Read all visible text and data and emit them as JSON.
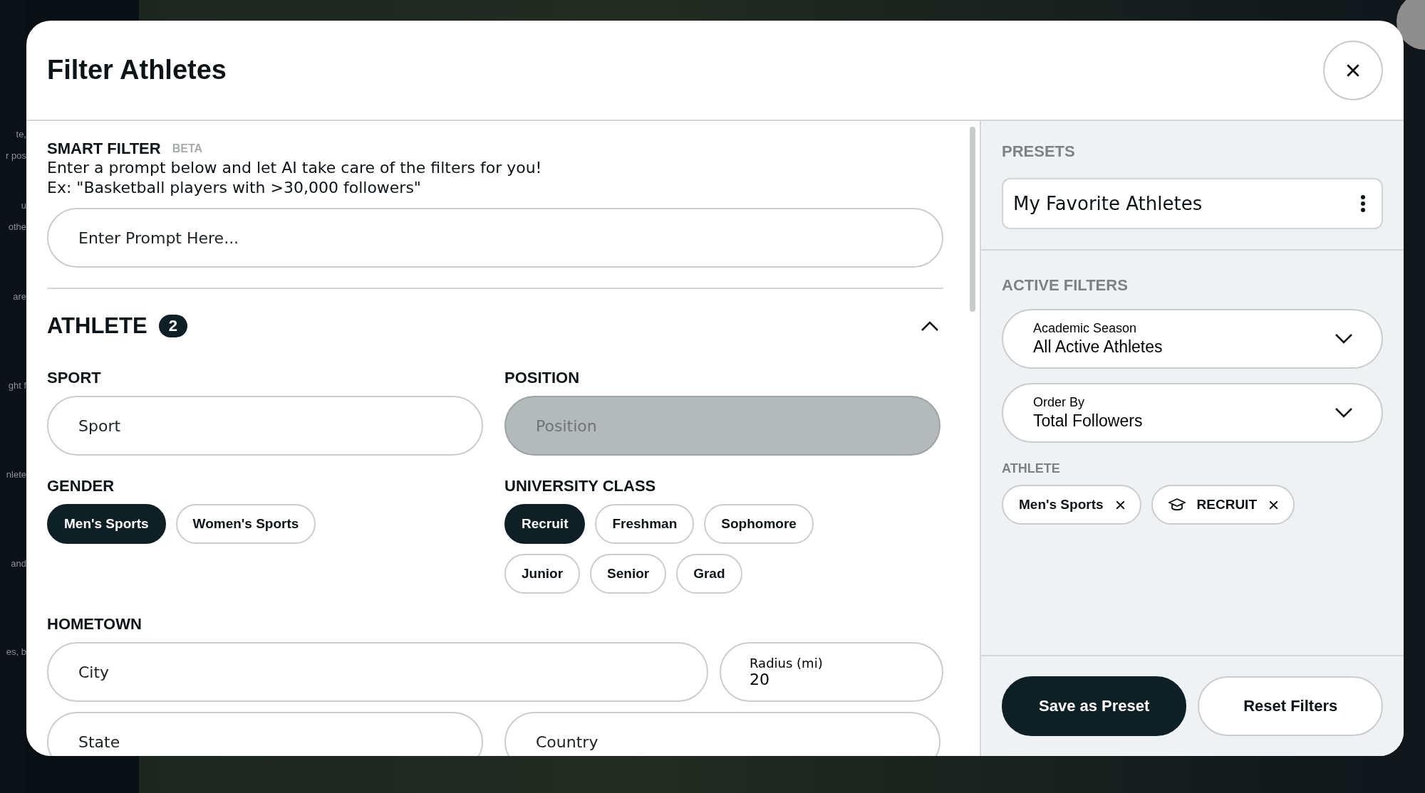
{
  "background": {
    "fragments": [
      "te,",
      "r pos",
      "u",
      "othe",
      "are",
      "ght f",
      "nlete",
      "and",
      "es, b"
    ]
  },
  "modal": {
    "title": "Filter Athletes"
  },
  "smart_filter": {
    "label": "SMART FILTER",
    "badge": "BETA",
    "description": "Enter a prompt below and let AI take care of the filters for you!",
    "example": "Ex: \"Basketball players with >30,000 followers\"",
    "prompt": {
      "placeholder": "Enter Prompt Here..."
    }
  },
  "athlete_section": {
    "title": "ATHLETE",
    "count": "2",
    "expanded": true,
    "sport": {
      "label": "SPORT",
      "placeholder": "Sport",
      "disabled": false
    },
    "position": {
      "label": "POSITION",
      "placeholder": "Position",
      "disabled": true
    },
    "gender": {
      "label": "GENDER",
      "options": [
        {
          "label": "Men's Sports",
          "selected": true
        },
        {
          "label": "Women's Sports",
          "selected": false
        }
      ]
    },
    "university_class": {
      "label": "UNIVERSITY CLASS",
      "options": [
        {
          "label": "Recruit",
          "selected": true
        },
        {
          "label": "Freshman",
          "selected": false
        },
        {
          "label": "Sophomore",
          "selected": false
        },
        {
          "label": "Junior",
          "selected": false
        },
        {
          "label": "Senior",
          "selected": false
        },
        {
          "label": "Grad",
          "selected": false
        }
      ]
    },
    "hometown": {
      "label": "HOMETOWN",
      "city": {
        "placeholder": "City"
      },
      "radius": {
        "label": "Radius (mi)",
        "value": "20"
      },
      "state": {
        "placeholder": "State"
      },
      "country": {
        "placeholder": "Country"
      }
    }
  },
  "presets": {
    "label": "PRESETS",
    "current": "My Favorite Athletes"
  },
  "active_filters": {
    "label": "ACTIVE FILTERS",
    "dropdowns": [
      {
        "label": "Academic Season",
        "value": "All Active Athletes"
      },
      {
        "label": "Order By",
        "value": "Total Followers"
      }
    ],
    "group_label": "ATHLETE",
    "tags": [
      {
        "label": "Men's Sports",
        "kind": "plain"
      },
      {
        "label": "RECRUIT",
        "kind": "class"
      }
    ]
  },
  "buttons": [
    {
      "label": "Save as Preset",
      "kind": "primary"
    },
    {
      "label": "Reset Filters",
      "kind": "secondary"
    }
  ]
}
